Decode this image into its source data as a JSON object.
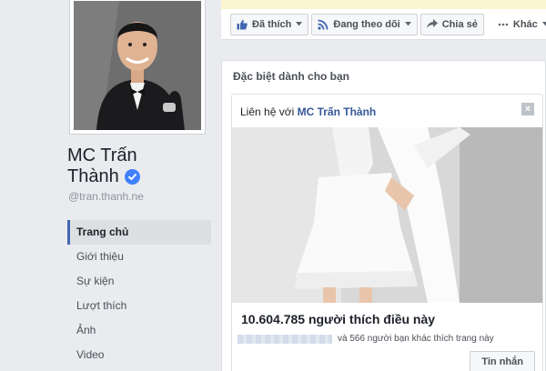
{
  "profile": {
    "name_line1": "MC Trấn",
    "name_line2": "Thành",
    "username": "@tran.thanh.ne",
    "verified": true
  },
  "nav": {
    "items": [
      {
        "label": "Trang chủ",
        "active": true
      },
      {
        "label": "Giới thiệu",
        "active": false
      },
      {
        "label": "Sự kiện",
        "active": false
      },
      {
        "label": "Lượt thích",
        "active": false
      },
      {
        "label": "Ảnh",
        "active": false
      },
      {
        "label": "Video",
        "active": false
      }
    ]
  },
  "actions": {
    "liked_label": "Đã thích",
    "following_label": "Đang theo dõi",
    "share_label": "Chia sẻ",
    "more_label": "Khác"
  },
  "promo": {
    "heading": "Đặc biệt dành cho bạn",
    "card": {
      "contact_prefix": "Liên hệ với ",
      "page_link": "MC Trấn Thành",
      "close_glyph": "×",
      "likes_text": "10.604.785 người thích điều này",
      "friends_text": "và 566 người bạn khác thích trang này",
      "message_button": "Tin nhắn"
    }
  },
  "colors": {
    "accent": "#4267b2",
    "link": "#365899",
    "verified_badge": "#4080ff",
    "notice_bar": "#fcf6d0"
  },
  "icons": [
    "like-icon",
    "rss-icon",
    "share-arrow-icon",
    "more-dots-icon",
    "check-icon",
    "close-icon",
    "chevron-down-icon"
  ]
}
